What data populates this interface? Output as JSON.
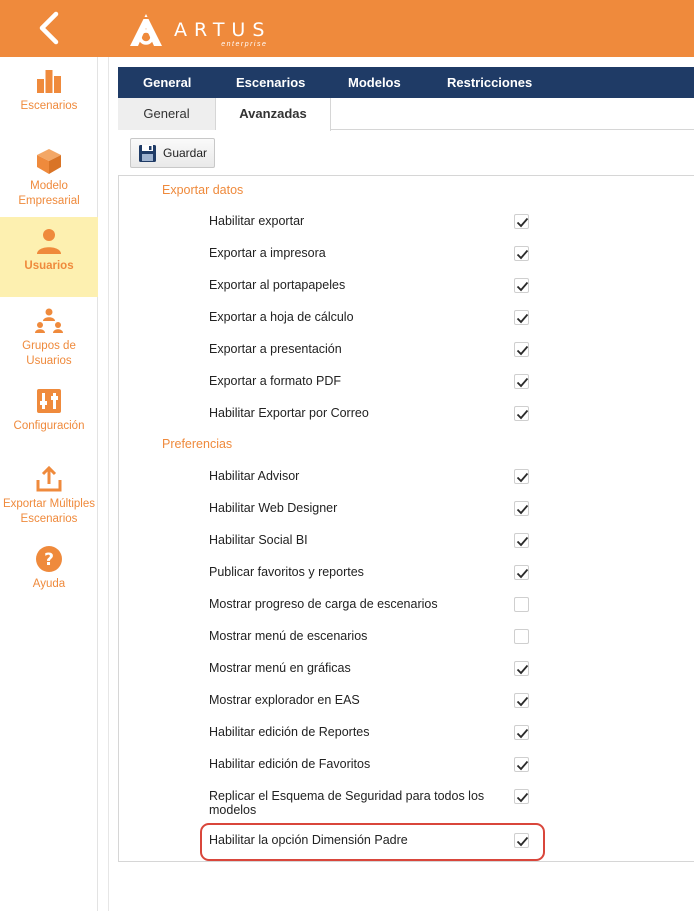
{
  "app": {
    "brand": "ARTUS",
    "brand_sub": "enterprise"
  },
  "colors": {
    "accent": "#ef8a3c",
    "navy": "#1f3b66",
    "active_side": "#fdf0b0",
    "highlight": "#d9463b"
  },
  "sidebar": {
    "items": [
      {
        "label": "Escenarios",
        "icon": "bar-chart-icon"
      },
      {
        "label": "Modelo Empresarial",
        "icon": "cube-icon"
      },
      {
        "label": "Usuarios",
        "icon": "user-icon",
        "active": true
      },
      {
        "label": "Grupos de Usuarios",
        "icon": "user-group-icon"
      },
      {
        "label": "Configuración",
        "icon": "settings-panel-icon"
      },
      {
        "label": "Exportar Múltiples Escenarios",
        "icon": "upload-icon"
      },
      {
        "label": "Ayuda",
        "icon": "help-icon"
      }
    ]
  },
  "tabs": {
    "main": [
      "General",
      "Escenarios",
      "Modelos",
      "Restricciones"
    ],
    "sub": [
      "General",
      "Avanzadas"
    ],
    "active_sub": "Avanzadas"
  },
  "toolbar": {
    "save_label": "Guardar"
  },
  "sections": [
    {
      "title": "Exportar datos",
      "options": [
        {
          "label": "Habilitar exportar",
          "checked": true
        },
        {
          "label": "Exportar a impresora",
          "checked": true
        },
        {
          "label": "Exportar al portapapeles",
          "checked": true
        },
        {
          "label": "Exportar a hoja de cálculo",
          "checked": true
        },
        {
          "label": "Exportar a presentación",
          "checked": true
        },
        {
          "label": "Exportar a formato PDF",
          "checked": true
        },
        {
          "label": "Habilitar Exportar por Correo",
          "checked": true
        }
      ]
    },
    {
      "title": "Preferencias",
      "options": [
        {
          "label": "Habilitar Advisor",
          "checked": true
        },
        {
          "label": "Habilitar Web Designer",
          "checked": true
        },
        {
          "label": "Habilitar Social BI",
          "checked": true
        },
        {
          "label": "Publicar favoritos y reportes",
          "checked": true
        },
        {
          "label": "Mostrar progreso de carga de escenarios",
          "checked": false
        },
        {
          "label": "Mostrar menú de escenarios",
          "checked": false
        },
        {
          "label": "Mostrar menú en gráficas",
          "checked": true
        },
        {
          "label": "Mostrar explorador en EAS",
          "checked": true
        },
        {
          "label": "Habilitar edición de Reportes",
          "checked": true
        },
        {
          "label": "Habilitar edición de Favoritos",
          "checked": true
        },
        {
          "label": "Replicar el Esquema de Seguridad para todos los modelos",
          "checked": true
        },
        {
          "label": "Habilitar la opción Dimensión Padre",
          "checked": true,
          "highlighted": true
        }
      ]
    }
  ]
}
